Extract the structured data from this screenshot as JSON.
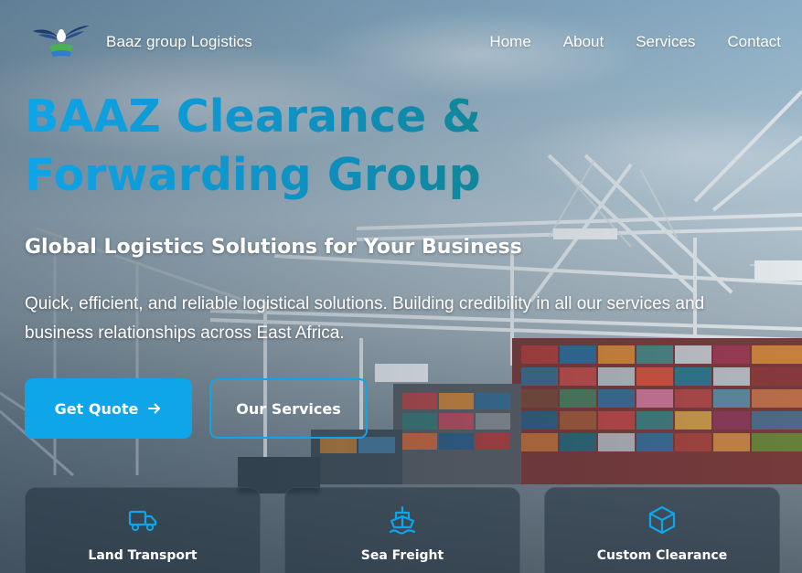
{
  "nav": {
    "brand": "Baaz group Logistics",
    "links": [
      "Home",
      "About",
      "Services",
      "Contact"
    ]
  },
  "hero": {
    "title": "BAAZ Clearance & Forwarding Group",
    "subtitle": "Global Logistics Solutions for Your Business",
    "description": "Quick, efficient, and reliable logistical solutions. Building credibility in all our services and business relationships across East Africa."
  },
  "buttons": {
    "quote": "Get Quote",
    "services": "Our Services"
  },
  "cards": [
    {
      "label": "Land Transport",
      "icon": "truck-icon"
    },
    {
      "label": "Sea Freight",
      "icon": "ship-icon"
    },
    {
      "label": "Custom Clearance",
      "icon": "box-icon"
    }
  ],
  "colors": {
    "accent": "#0ea5e9",
    "title_gradient_end": "#157a62",
    "card_bg": "rgba(40,55,68,0.62)",
    "text": "#ffffff"
  }
}
